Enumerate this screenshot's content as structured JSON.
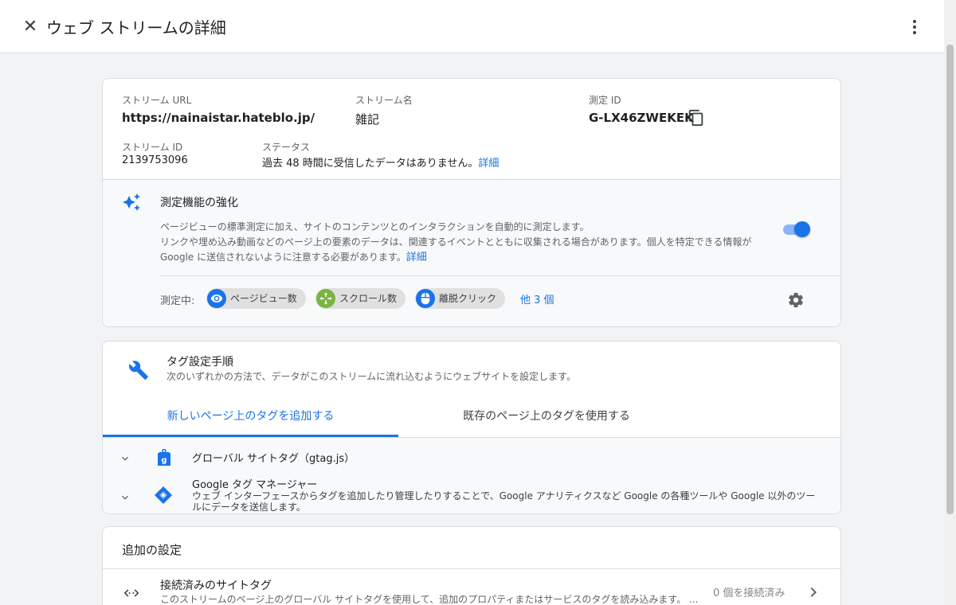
{
  "header": {
    "title": "ウェブ ストリームの詳細",
    "close_glyph": "✕"
  },
  "stream": {
    "url_label": "ストリーム URL",
    "url_value": "https://nainaistar.hateblo.jp/",
    "name_label": "ストリーム名",
    "name_value": "雑記",
    "measurement_id_label": "測定 ID",
    "measurement_id_value": "G-LX46ZWEKEK",
    "stream_id_label": "ストリーム ID",
    "stream_id_value": "2139753096",
    "status_label": "ステータス",
    "status_value": "過去 48 時間に受信したデータはありません。",
    "status_link": "詳細"
  },
  "enhanced_measurement": {
    "title": "測定機能の強化",
    "desc_line1": "ページビューの標準測定に加え、サイトのコンテンツとのインタラクションを自動的に測定します。",
    "desc_line2": "リンクや埋め込み動画などのページ上の要素のデータは、関連するイベントとともに収集される場合があります。個人を特定できる情報が",
    "desc_line3": "Google に送信されないように注意する必要があります。",
    "desc_link": "詳細",
    "enabled": true,
    "measuring_label": "測定中:",
    "chips": [
      {
        "label": "ページビュー数",
        "icon": "eye-icon",
        "color": "#1a73e8"
      },
      {
        "label": "スクロール数",
        "icon": "scroll-icon",
        "color": "#7cb342"
      },
      {
        "label": "離脱クリック",
        "icon": "mouse-icon",
        "color": "#1a73e8"
      }
    ],
    "more_link": "他 3 個"
  },
  "tagging": {
    "title": "タグ設定手順",
    "subtitle": "次のいずれかの方法で、データがこのストリームに流れ込むようにウェブサイトを設定します。",
    "tabs": [
      {
        "label": "新しいページ上のタグを追加する",
        "active": true
      },
      {
        "label": "既存のページ上のタグを使用する",
        "active": false
      }
    ],
    "items": [
      {
        "title": "グローバル サイトタグ（gtag.js）",
        "icon": "gtag-icon"
      },
      {
        "title": "Google タグ マネージャー",
        "desc_line1": "ウェブ インターフェースからタグを追加したり管理したりすることで、Google アナリティクスなど Google の各種ツールや Google 以外のツー",
        "desc_line2": "ルにデータを送信します。",
        "icon": "gtm-icon"
      }
    ]
  },
  "additional": {
    "title": "追加の設定",
    "items": [
      {
        "title": "接続済みのサイトタグ",
        "desc": "このストリームのページ上のグローバル サイトタグを使用して、追加のプロパティまたはサービスのタグを読み込みます。 ...",
        "status": "0 個を接続済み"
      }
    ]
  },
  "colors": {
    "accent": "#1a73e8",
    "muted": "#5f6368",
    "border": "#dadce0"
  }
}
